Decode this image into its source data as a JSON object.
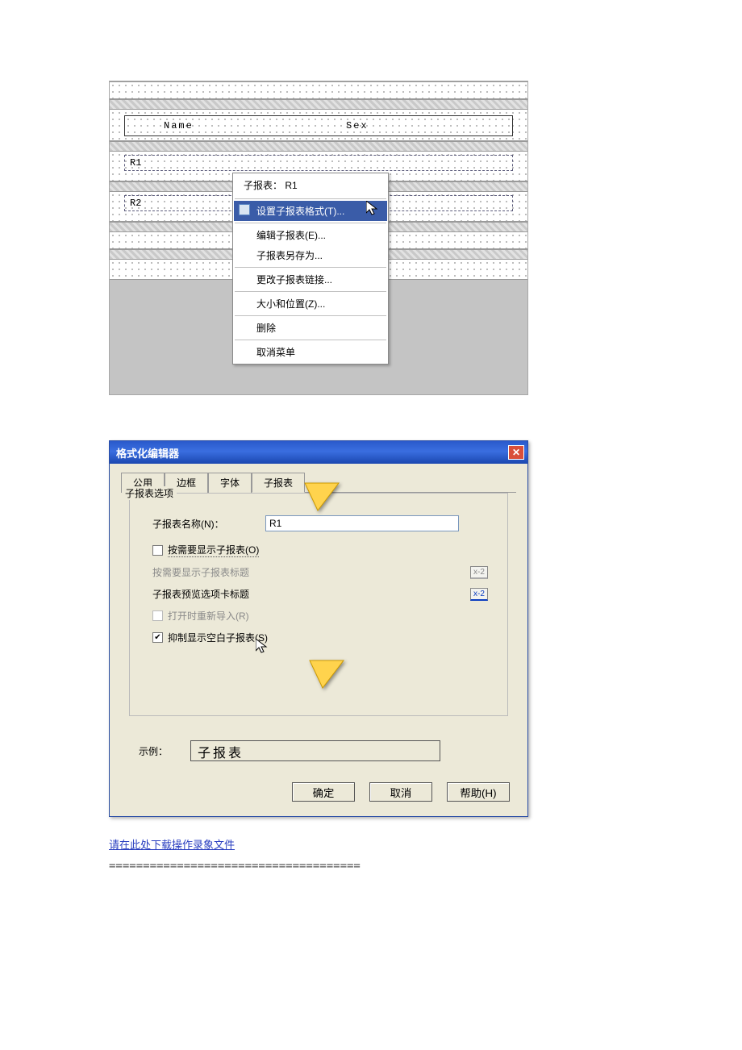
{
  "designer": {
    "header": {
      "col1": "Name",
      "col2": "Sex"
    },
    "sub1": "R1",
    "sub2": "R2"
  },
  "ctxmenu": {
    "title": "子报表： R1",
    "format": "设置子报表格式(T)...",
    "edit": "编辑子报表(E)...",
    "saveas": "子报表另存为...",
    "relink": "更改子报表链接...",
    "sizepos": "大小和位置(Z)...",
    "delete": "删除",
    "cancel": "取消菜单"
  },
  "dialog": {
    "title": "格式化编辑器",
    "tabs": {
      "common": "公用",
      "border": "边框",
      "font": "字体",
      "subreport": "子报表"
    },
    "group_title": "子报表选项",
    "name_label": "子报表名称(N)：",
    "name_value": "R1",
    "ondemand": "按需要显示子报表(O)",
    "ondemand_caption": "按需要显示子报表标题",
    "preview_caption": "子报表预览选项卡标题",
    "reimport": "打开时重新导入(R)",
    "suppress_blank": "抑制显示空白子报表(S)",
    "x2": "x-2",
    "sample_label": "示例：",
    "sample_value": "子报表",
    "ok": "确定",
    "cancel": "取消",
    "help": "帮助(H)"
  },
  "footer": {
    "download": "请在此处下载操作录象文件",
    "divider": "====================================="
  }
}
